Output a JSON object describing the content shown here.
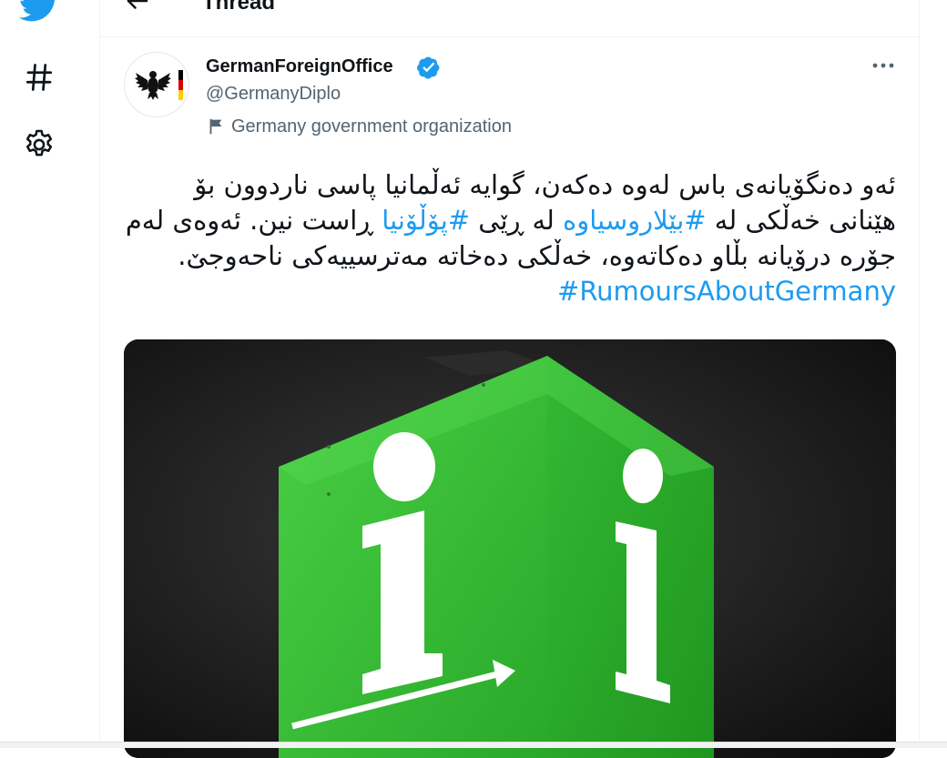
{
  "nav": {
    "twitter_icon": "twitter-bird-icon",
    "explore_icon": "hashtag-icon",
    "settings_icon": "gear-icon"
  },
  "header": {
    "title": "Thread",
    "back_icon": "arrow-left-icon"
  },
  "tweet": {
    "author_name": "GermanForeignOffice",
    "handle": "@GermanyDiplo",
    "verified": true,
    "label": "Germany government organization",
    "label_icon": "flag-icon",
    "text": {
      "part1": "ئەو دەنگۆیانەی باس لەوە دەکەن، گوایە ئەڵمانیا پاسی ناردوون بۆ هێنانی خەڵکی لە",
      "hashtag1": "#بێلاروسیاوە",
      "part2": "لە ڕێی",
      "hashtag2": "#پۆڵۆنیا",
      "part3": "ڕاست نین. ئەوەی لەم جۆرە درۆیانە بڵاو دەکاتەوە، خەڵکی دەخاتە مەترسییەکی ناحەوجێ.",
      "hashtag3": "#RumoursAboutGermany"
    },
    "media": {
      "description_icon": "info-sign-image",
      "colors": {
        "green": "#3cc43a",
        "dark": "#1a1a1a"
      }
    }
  },
  "colors": {
    "accent": "#1d9bf0",
    "text": "#0f1419",
    "muted": "#536471"
  }
}
